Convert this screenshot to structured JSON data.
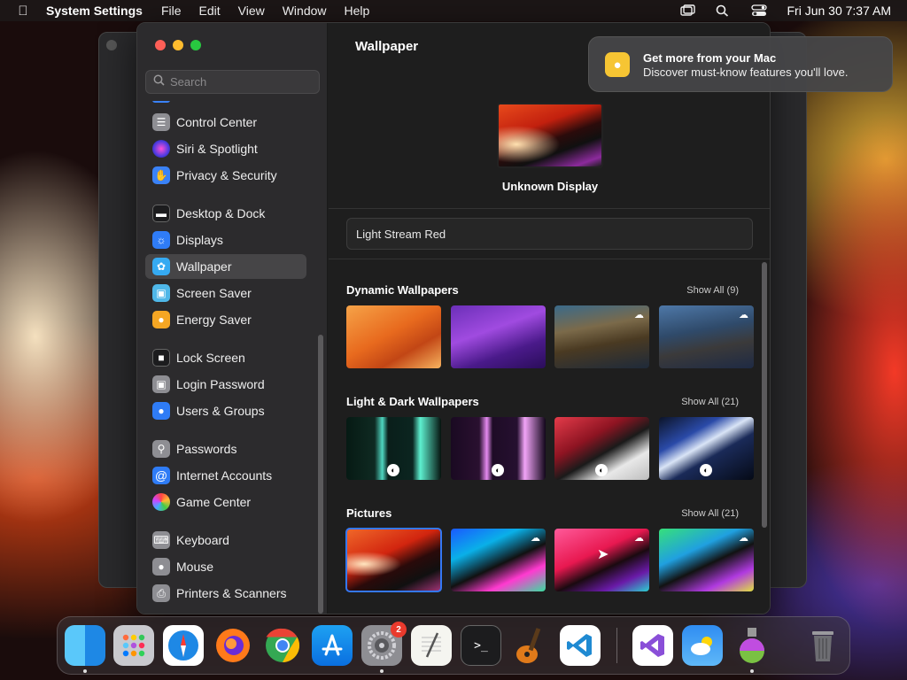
{
  "menubar": {
    "app_name": "System Settings",
    "menus": [
      "File",
      "Edit",
      "View",
      "Window",
      "Help"
    ],
    "datetime": "Fri Jun 30  7:37 AM"
  },
  "search": {
    "placeholder": "Search"
  },
  "sidebar": {
    "items": [
      {
        "label": "Control Center",
        "icon": "control-center-icon",
        "color": "#8e8e93"
      },
      {
        "label": "Siri & Spotlight",
        "icon": "siri-icon",
        "color": "#a04fd8"
      },
      {
        "label": "Privacy & Security",
        "icon": "hand-icon",
        "color": "#3a82f7"
      },
      {
        "label": "Desktop & Dock",
        "icon": "dock-icon",
        "color": "#1c1c1e"
      },
      {
        "label": "Displays",
        "icon": "sun-icon",
        "color": "#2f7cf6"
      },
      {
        "label": "Wallpaper",
        "icon": "wallpaper-icon",
        "color": "#35aaf2"
      },
      {
        "label": "Screen Saver",
        "icon": "screensaver-icon",
        "color": "#4fb7e8"
      },
      {
        "label": "Energy Saver",
        "icon": "bulb-icon",
        "color": "#f5a623"
      },
      {
        "label": "Lock Screen",
        "icon": "lock-icon",
        "color": "#1c1c1e"
      },
      {
        "label": "Login Password",
        "icon": "padlock-icon",
        "color": "#8e8e93"
      },
      {
        "label": "Users & Groups",
        "icon": "users-icon",
        "color": "#2f7cf6"
      },
      {
        "label": "Passwords",
        "icon": "key-icon",
        "color": "#8e8e93"
      },
      {
        "label": "Internet Accounts",
        "icon": "at-icon",
        "color": "#2f7cf6"
      },
      {
        "label": "Game Center",
        "icon": "game-center-icon",
        "color": "#f4f4f4"
      },
      {
        "label": "Keyboard",
        "icon": "keyboard-icon",
        "color": "#8e8e93"
      },
      {
        "label": "Mouse",
        "icon": "mouse-icon",
        "color": "#8e8e93"
      },
      {
        "label": "Printers & Scanners",
        "icon": "printer-icon",
        "color": "#8e8e93"
      }
    ],
    "selected": "Wallpaper"
  },
  "content": {
    "title": "Wallpaper",
    "display_name": "Unknown Display",
    "current_wallpaper": "Light Stream Red",
    "sections": [
      {
        "title": "Dynamic Wallpapers",
        "show_all": "Show All (9)"
      },
      {
        "title": "Light & Dark Wallpapers",
        "show_all": "Show All (21)"
      },
      {
        "title": "Pictures",
        "show_all": "Show All (21)"
      }
    ]
  },
  "notification": {
    "title": "Get more from your Mac",
    "body": "Discover must-know features you'll love.",
    "icon": "tips-bulb-icon"
  },
  "dock": {
    "apps": [
      "Finder",
      "Launchpad",
      "Safari",
      "Firefox",
      "Chrome",
      "App Store",
      "System Settings",
      "TextEdit",
      "Terminal",
      "GarageBand",
      "Visual Studio Code",
      "Visual Studio",
      "Weather",
      "Disk Utility"
    ],
    "system_settings_badge": "2",
    "trash": "Trash"
  }
}
